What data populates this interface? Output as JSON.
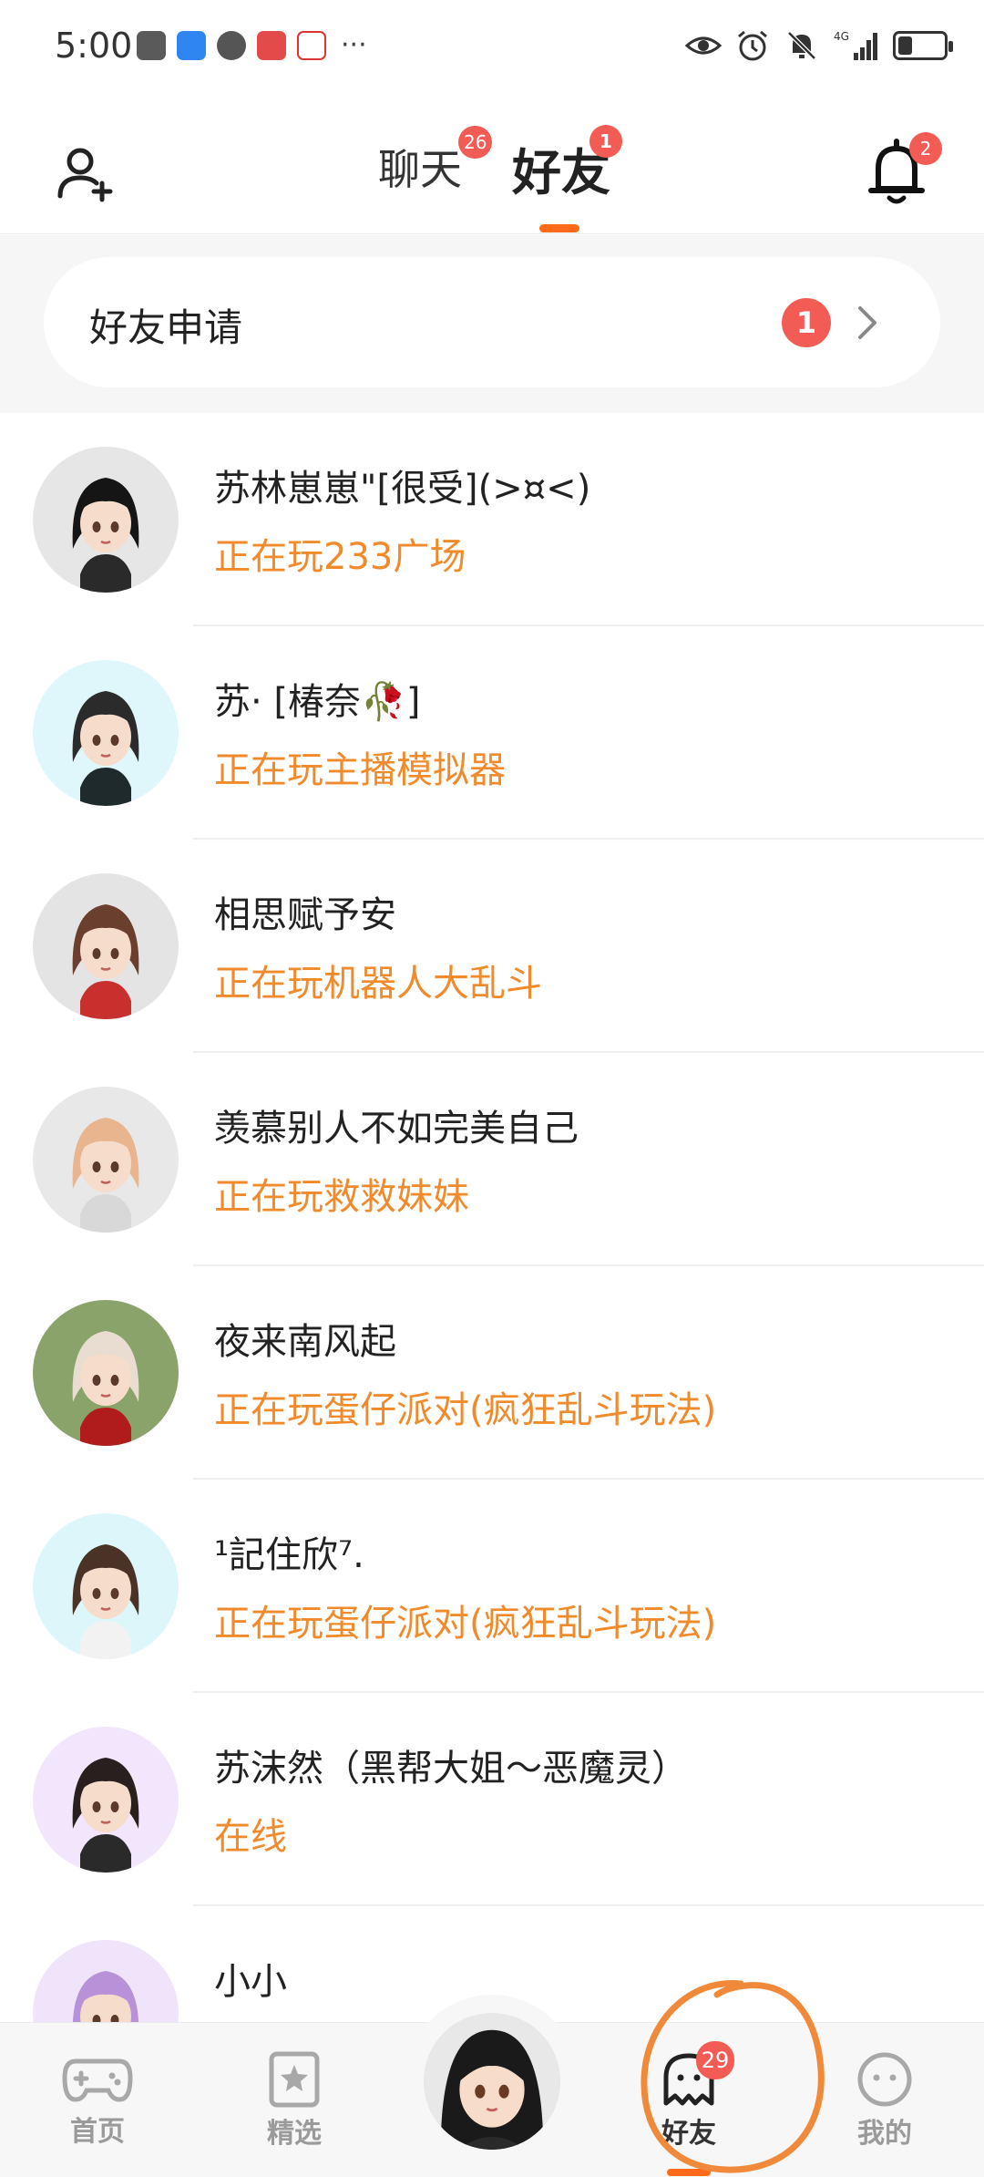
{
  "status_bar": {
    "time": "5:00",
    "more": "···",
    "battery_level": 0.3
  },
  "header": {
    "tabs": [
      {
        "label": "聊天",
        "badge": "26"
      },
      {
        "label": "好友",
        "badge": "1"
      }
    ],
    "active_tab": "好友",
    "notification_badge": "2"
  },
  "friend_request": {
    "label": "好友申请",
    "count": "1"
  },
  "friends": [
    {
      "name": "苏林崽崽\"[很受](>¤<)",
      "status": "正在玩233广场",
      "avatar_bg": "#e6e6e6",
      "hair": "#151515",
      "outfit": "#2a2a2a"
    },
    {
      "name": "苏· [椿奈🥀]",
      "status": "正在玩主播模拟器",
      "avatar_bg": "#dff7fb",
      "hair": "#2b2b2b",
      "outfit": "#1f2a2c"
    },
    {
      "name": "相思赋予安",
      "status": "正在玩机器人大乱斗",
      "avatar_bg": "#e4e4e4",
      "hair": "#6b3f2e",
      "outfit": "#c8302e"
    },
    {
      "name": "羡慕别人不如完美自己",
      "status": "正在玩救救妹妹",
      "avatar_bg": "#e8e8e8",
      "hair": "#e8b58e",
      "outfit": "#d8d8d8"
    },
    {
      "name": "夜来南风起",
      "status": "正在玩蛋仔派对(疯狂乱斗玩法)",
      "avatar_bg": "#8aa36a",
      "hair": "#e9ddd2",
      "outfit": "#b01c1c"
    },
    {
      "name": "¹記住欣⁷.",
      "status": "正在玩蛋仔派对(疯狂乱斗玩法)",
      "avatar_bg": "#ddf6fa",
      "hair": "#4a3326",
      "outfit": "#f2f2f2"
    },
    {
      "name": "苏沫然（黑帮大姐～恶魔灵）",
      "status": "在线",
      "avatar_bg": "#f1e6fb",
      "hair": "#2a1f1f",
      "outfit": "#2a2a2a"
    },
    {
      "name": "小小",
      "status": "",
      "avatar_bg": "#efe4fa",
      "hair": "#b892d8",
      "outfit": "#8d6cc4"
    }
  ],
  "bottom_nav": {
    "items": [
      {
        "label": "首页",
        "icon": "gamepad-icon"
      },
      {
        "label": "精选",
        "icon": "star-bookmark-icon"
      },
      {
        "label": "好友",
        "icon": "ghost-friends-icon",
        "badge": "29"
      },
      {
        "label": "我的",
        "icon": "face-icon"
      }
    ],
    "active": "好友"
  },
  "colors": {
    "accent": "#ff6a1a",
    "status_text": "#f08a2b",
    "badge": "#f25c54",
    "annotation": "#f08a3a"
  }
}
